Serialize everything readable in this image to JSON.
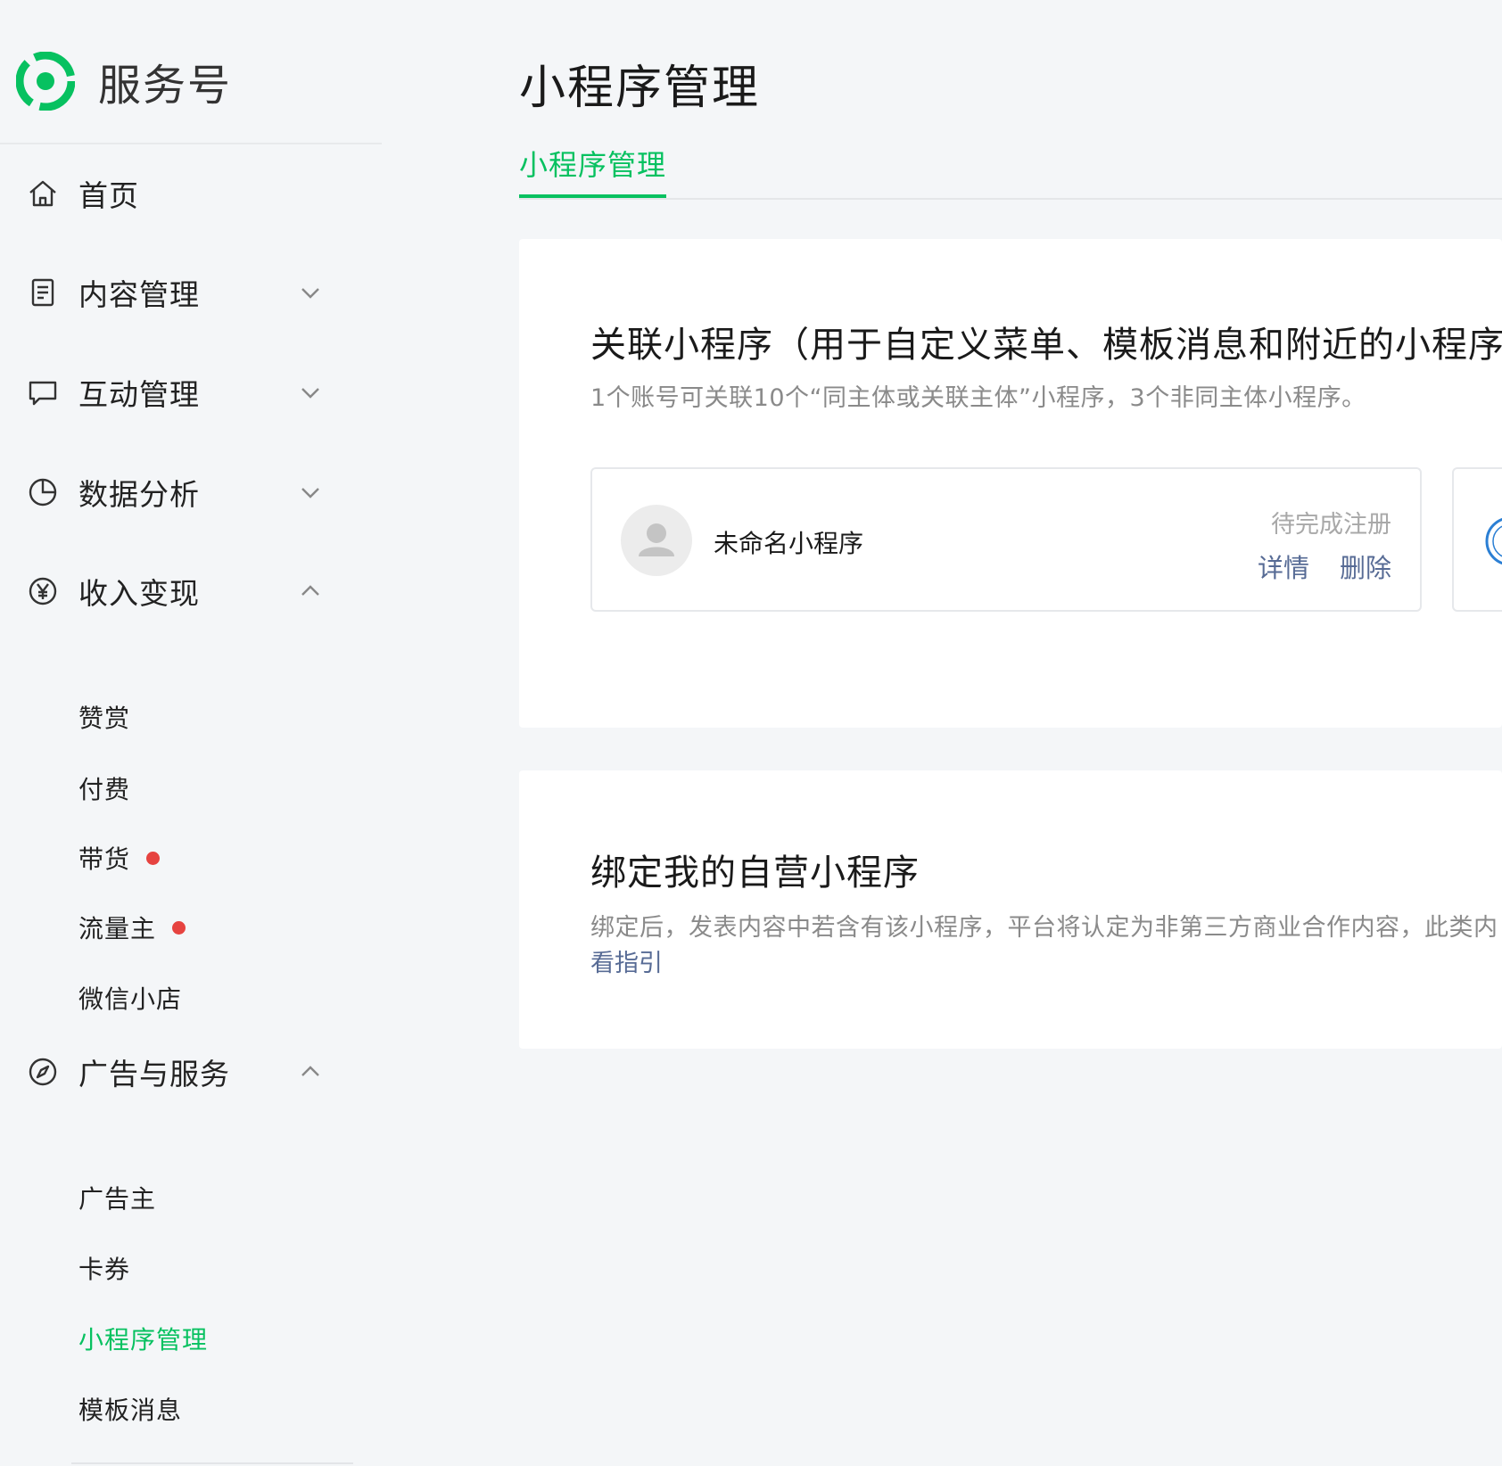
{
  "brand": {
    "name": "服务号",
    "color": "#07c160",
    "logo_icon": "service-account-logo"
  },
  "sidebar": {
    "items": [
      {
        "label": "首页",
        "icon": "home-icon"
      },
      {
        "label": "内容管理",
        "icon": "document-icon",
        "expanded": false
      },
      {
        "label": "互动管理",
        "icon": "chat-icon",
        "expanded": false
      },
      {
        "label": "数据分析",
        "icon": "pie-chart-icon",
        "expanded": false
      },
      {
        "label": "收入变现",
        "icon": "yen-icon",
        "expanded": true,
        "children": [
          {
            "label": "赞赏"
          },
          {
            "label": "付费"
          },
          {
            "label": "带货",
            "badge_dot": true
          },
          {
            "label": "流量主",
            "badge_dot": true
          },
          {
            "label": "微信小店"
          }
        ]
      },
      {
        "label": "广告与服务",
        "icon": "compass-icon",
        "expanded": true,
        "children": [
          {
            "label": "广告主"
          },
          {
            "label": "卡券"
          },
          {
            "label": "小程序管理",
            "active": true
          },
          {
            "label": "模板消息"
          }
        ]
      }
    ]
  },
  "main": {
    "title": "小程序管理",
    "tabs": [
      {
        "label": "小程序管理",
        "active": true
      }
    ],
    "linked_section": {
      "title": "关联小程序（用于自定义菜单、模板消息和附近的小程序）",
      "description": "1个账号可关联10个“同主体或关联主体”小程序，3个非同主体小程序。",
      "mini_programs": [
        {
          "name": "未命名小程序",
          "status": "待完成注册",
          "actions": [
            "详情",
            "删除"
          ]
        }
      ]
    },
    "bind_section": {
      "title": "绑定我的自营小程序",
      "description": "绑定后，发表内容中若含有该小程序，平台将认定为非第三方商业合作内容，此类内",
      "link": "看指引"
    }
  },
  "colors": {
    "accent": "#07c160",
    "link": "#576b95",
    "badge": "#e64340",
    "muted": "#8a8a8a"
  }
}
